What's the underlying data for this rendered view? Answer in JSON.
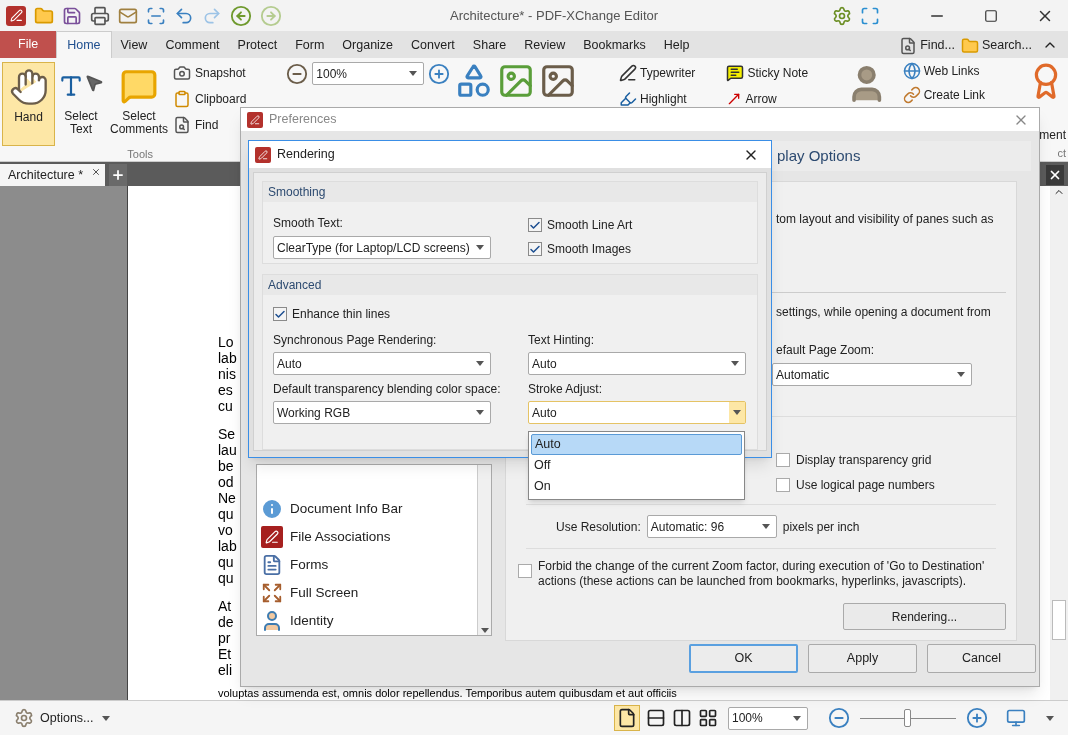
{
  "window": {
    "title": "Architecture* - PDF-XChange Editor"
  },
  "menu_tabs": [
    {
      "label": "File",
      "kind": "file",
      "selected": false
    },
    {
      "label": "Home",
      "kind": "tab",
      "selected": true
    },
    {
      "label": "View",
      "kind": "tab",
      "selected": false
    },
    {
      "label": "Comment",
      "kind": "tab",
      "selected": false
    },
    {
      "label": "Protect",
      "kind": "tab",
      "selected": false
    },
    {
      "label": "Form",
      "kind": "tab",
      "selected": false
    },
    {
      "label": "Organize",
      "kind": "tab",
      "selected": false
    },
    {
      "label": "Convert",
      "kind": "tab",
      "selected": false
    },
    {
      "label": "Share",
      "kind": "tab",
      "selected": false
    },
    {
      "label": "Review",
      "kind": "tab",
      "selected": false
    },
    {
      "label": "Bookmarks",
      "kind": "tab",
      "selected": false
    },
    {
      "label": "Help",
      "kind": "tab",
      "selected": false
    }
  ],
  "menu_right": [
    "Find...",
    "Search..."
  ],
  "ribbon": {
    "large_tools": [
      {
        "label": "Hand",
        "selected": true
      },
      {
        "label": "Select Text",
        "selected": false
      },
      {
        "label": "Select Comments",
        "selected": false
      }
    ],
    "small_tools": [
      "Snapshot",
      "Clipboard",
      "Find"
    ],
    "tools_group_label": "Tools",
    "zoom_value": "100%",
    "annotations": [
      "Typewriter",
      "Sticky Note",
      "Highlight",
      "Arrow"
    ],
    "links": [
      "Web Links",
      "Create Link"
    ],
    "cut_label": "ment",
    "cut_group_label": "ct"
  },
  "document_tab": {
    "label": "Architecture *"
  },
  "document_fragments": [
    [
      "Lo",
      "lab",
      "nis",
      "es",
      "cu"
    ],
    [
      "Se",
      "lau",
      "be",
      "od",
      "Ne",
      "qu",
      "vo",
      "lab",
      "qu",
      "qu"
    ],
    [
      "At",
      "de",
      "pr",
      "Et",
      "eli"
    ]
  ],
  "document_bottom_line": "voluptas assumenda est, omnis dolor repellendus. Temporibus autem quibusdam et aut officiis",
  "preferences": {
    "title": "Preferences",
    "section_title": "play Options",
    "text_1": "tom layout and visibility of panes such as",
    "text_2": "settings, while opening a document from",
    "zoom_label": "efault Page Zoom:",
    "zoom_value": "Automatic",
    "options": [
      {
        "label": "Display transparency grid",
        "checked": false
      },
      {
        "label": "Use logical page numbers",
        "checked": false
      }
    ],
    "resolution_label": "Use Resolution:",
    "resolution_value": "Automatic: 96",
    "resolution_unit": "pixels per inch",
    "forbid": {
      "label": "Forbid the change of the current Zoom factor, during execution of 'Go to Destination' actions (these actions can be launched from bookmarks, hyperlinks, javascripts).",
      "checked": false
    },
    "rendering_button": "Rendering...",
    "categories": [
      {
        "label": "Document Info Bar",
        "kind": "info"
      },
      {
        "label": "File Associations",
        "kind": "pdf"
      },
      {
        "label": "Forms",
        "kind": "forms"
      },
      {
        "label": "Full Screen",
        "kind": "fullscreen"
      },
      {
        "label": "Identity",
        "kind": "identity"
      }
    ],
    "buttons": [
      {
        "label": "OK",
        "kind": "default"
      },
      {
        "label": "Apply",
        "kind": "normal"
      },
      {
        "label": "Cancel",
        "kind": "normal"
      }
    ]
  },
  "rendering": {
    "title": "Rendering",
    "smoothing": {
      "title": "Smoothing",
      "smooth_text_label": "Smooth Text:",
      "smooth_text_value": "ClearType (for Laptop/LCD screens)",
      "checks": [
        {
          "label": "Smooth Line Art",
          "checked": true
        },
        {
          "label": "Smooth Images",
          "checked": true
        }
      ]
    },
    "advanced": {
      "title": "Advanced",
      "enhance": {
        "label": "Enhance thin lines",
        "checked": true
      },
      "fields": [
        {
          "label": "Synchronous Page Rendering:",
          "value": "Auto",
          "open": false
        },
        {
          "label": "Text Hinting:",
          "value": "Auto",
          "open": false
        },
        {
          "label": "Default transparency blending color space:",
          "value": "Working RGB",
          "open": false
        },
        {
          "label": "Stroke Adjust:",
          "value": "Auto",
          "open": true
        }
      ]
    },
    "dropdown_options": [
      {
        "label": "Auto",
        "selected": true
      },
      {
        "label": "Off",
        "selected": false
      },
      {
        "label": "On",
        "selected": false
      }
    ]
  },
  "status_bar": {
    "options": "Options...",
    "zoom_value": "100%",
    "level": 0.5
  }
}
